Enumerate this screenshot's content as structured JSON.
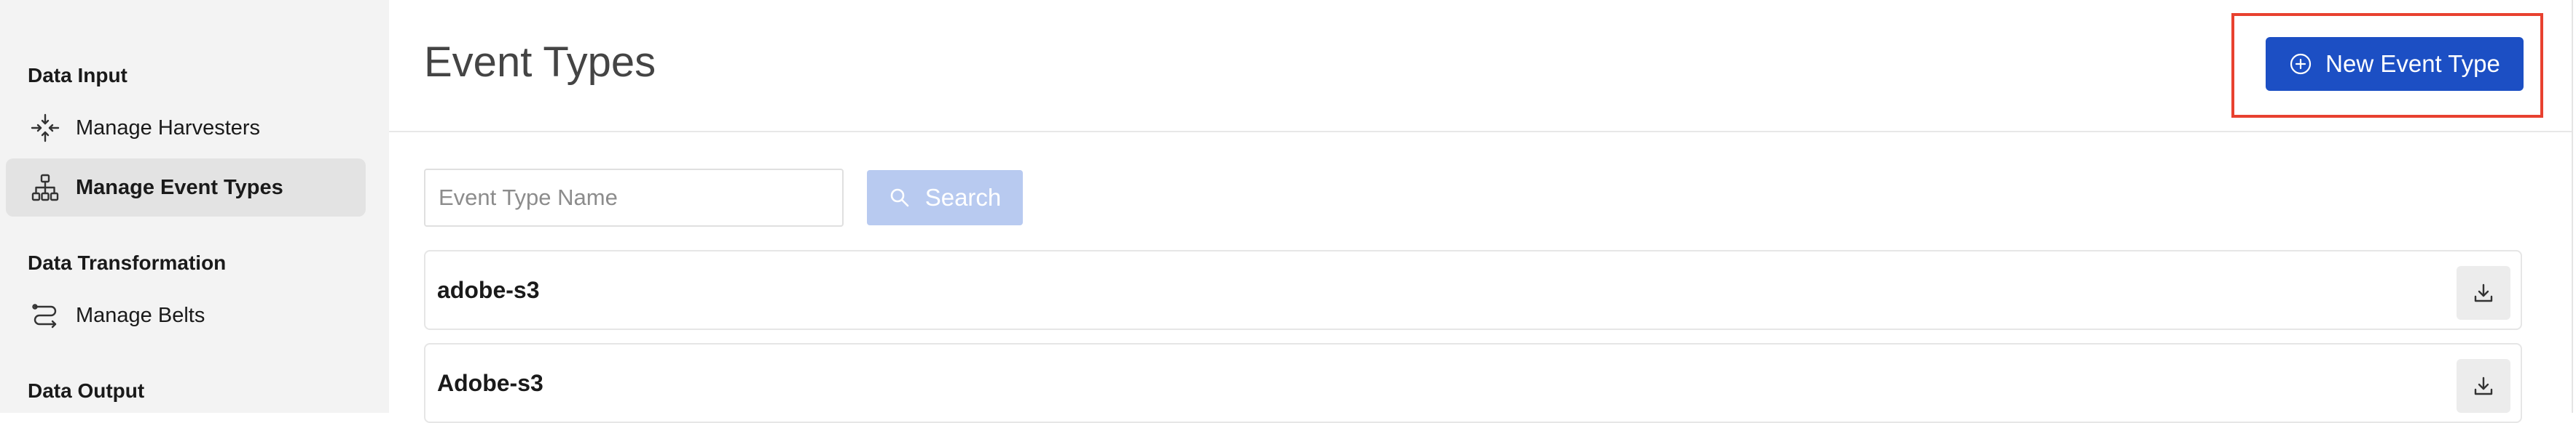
{
  "sidebar": {
    "sections": [
      {
        "title": "Data Input"
      },
      {
        "title": "Data Transformation"
      },
      {
        "title": "Data Output"
      }
    ],
    "items": [
      {
        "label": "Manage Harvesters",
        "icon": "harvester-icon"
      },
      {
        "label": "Manage Event Types",
        "icon": "hierarchy-icon",
        "active": true
      },
      {
        "label": "Manage Belts",
        "icon": "belt-icon"
      }
    ]
  },
  "header": {
    "title": "Event Types",
    "new_button_label": "New Event Type"
  },
  "search": {
    "placeholder": "Event Type Name",
    "value": "",
    "button_label": "Search"
  },
  "event_types": [
    {
      "name": "adobe-s3"
    },
    {
      "name": "Adobe-s3"
    }
  ],
  "colors": {
    "primary": "#1c4fc4",
    "primary_disabled": "#b8caf0",
    "highlight": "#e8412f",
    "sidebar_bg": "#f3f3f3"
  }
}
